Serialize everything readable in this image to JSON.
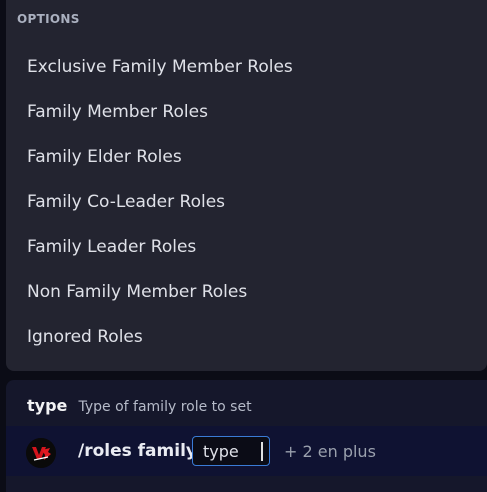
{
  "options": {
    "header": "OPTIONS",
    "items": [
      {
        "label": "Exclusive Family Member Roles"
      },
      {
        "label": "Family Member Roles"
      },
      {
        "label": "Family Elder Roles"
      },
      {
        "label": "Family Co-Leader Roles"
      },
      {
        "label": "Family Leader Roles"
      },
      {
        "label": "Non Family Member Roles"
      },
      {
        "label": "Ignored Roles"
      }
    ]
  },
  "hint": {
    "param_name": "type",
    "param_description": "Type of family role to set"
  },
  "command": {
    "name": "/roles family",
    "active_param": "type",
    "more_params": "+ 2 en plus",
    "bot_icon": "bot-avatar-icon"
  },
  "colors": {
    "panel_bg": "#232430",
    "composer_bg": "#15172b",
    "accent_border": "#3a7bd5"
  }
}
